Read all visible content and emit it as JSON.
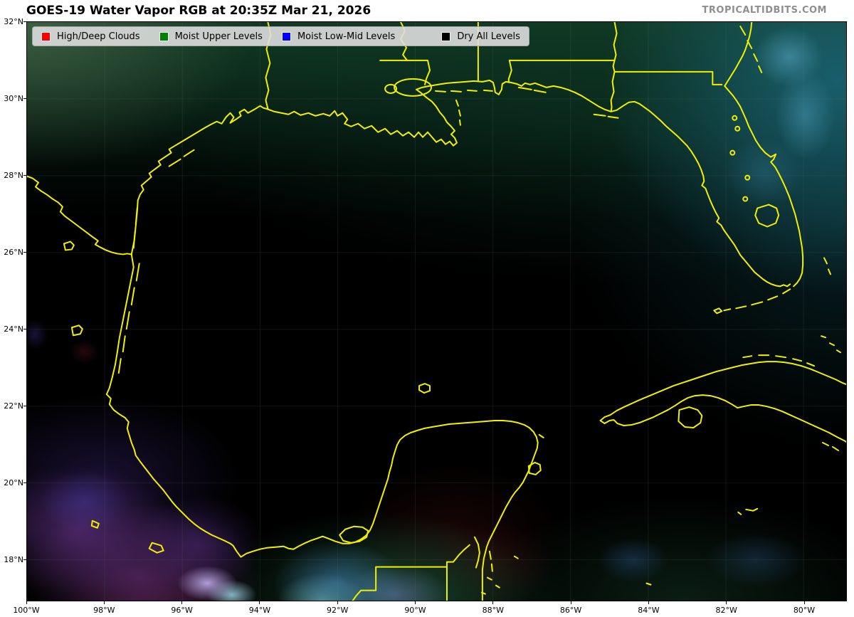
{
  "title": "GOES-19 Water Vapor RGB at 20:35Z Mar 21, 2026",
  "watermark": "TROPICALTIDBITS.COM",
  "legend": {
    "items": [
      {
        "label": "High/Deep Clouds",
        "color": "#ff0000"
      },
      {
        "label": "Moist Upper Levels",
        "color": "#008000"
      },
      {
        "label": "Moist Low-Mid Levels",
        "color": "#0000ff"
      },
      {
        "label": "Dry All Levels",
        "color": "#000000"
      }
    ]
  },
  "axes": {
    "lat_labels": [
      "32°N",
      "30°N",
      "28°N",
      "26°N",
      "24°N",
      "22°N",
      "20°N",
      "18°N"
    ],
    "lon_labels": [
      "100°W",
      "98°W",
      "96°W",
      "94°W",
      "92°W",
      "90°W",
      "88°W",
      "86°W",
      "84°W",
      "82°W",
      "80°W"
    ]
  },
  "map": {
    "region": "Gulf of Mexico",
    "coastline_color": "#f0f000",
    "background_color": "#000000",
    "features": [
      "texas-coast",
      "rio-grande",
      "mississippi-delta",
      "florida-peninsula",
      "lake-okeechobee",
      "yucatan-peninsula",
      "cuba",
      "isla-de-la-juventud",
      "state-borders"
    ]
  }
}
